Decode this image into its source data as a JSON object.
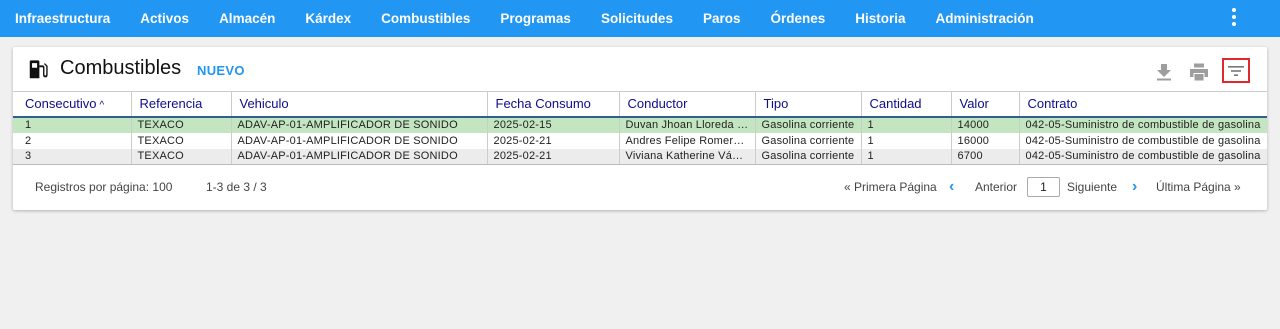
{
  "nav": {
    "items": [
      "Infraestructura",
      "Activos",
      "Almacén",
      "Kárdex",
      "Combustibles",
      "Programas",
      "Solicitudes",
      "Paros",
      "Órdenes",
      "Historia",
      "Administración"
    ]
  },
  "header": {
    "title": "Combustibles",
    "new_label": "NUEVO"
  },
  "icons": {
    "fuel": "fuel-pump-icon",
    "download": "download-icon",
    "print": "print-icon",
    "filter": "filter-icon",
    "more": "more-vert-icon"
  },
  "colors": {
    "accent": "#2196f3",
    "header_text": "#0d0d8c",
    "selected_row": "#c3e6c0",
    "filter_highlight": "#e0282e"
  },
  "table": {
    "columns": [
      "Consecutivo",
      "Referencia",
      "Vehiculo",
      "Fecha Consumo",
      "Conductor",
      "Tipo",
      "Cantidad",
      "Valor",
      "Contrato"
    ],
    "sort_indicator": "^",
    "rows": [
      [
        "1",
        "TEXACO",
        "ADAV-AP-01-AMPLIFICADOR DE SONIDO",
        "2025-02-15",
        "Duvan Jhoan Lloreda P...",
        "Gasolina corriente",
        "1",
        "14000",
        "042-05-Suministro de combustible de gasolina"
      ],
      [
        "2",
        "TEXACO",
        "ADAV-AP-01-AMPLIFICADOR DE SONIDO",
        "2025-02-21",
        "Andres Felipe Romero ...",
        "Gasolina corriente",
        "1",
        "16000",
        "042-05-Suministro de combustible de gasolina"
      ],
      [
        "3",
        "TEXACO",
        "ADAV-AP-01-AMPLIFICADOR DE SONIDO",
        "2025-02-21",
        "Viviana Katherine Vásq...",
        "Gasolina corriente",
        "1",
        "6700",
        "042-05-Suministro de combustible de gasolina"
      ]
    ]
  },
  "pagination": {
    "per_page_label": "Registros por página: 100",
    "range_label": "1-3 de 3 / 3",
    "first_label": "« Primera Página",
    "prev_label": "Anterior",
    "page_value": "1",
    "next_label": "Siguiente",
    "last_label": "Última Página »"
  }
}
